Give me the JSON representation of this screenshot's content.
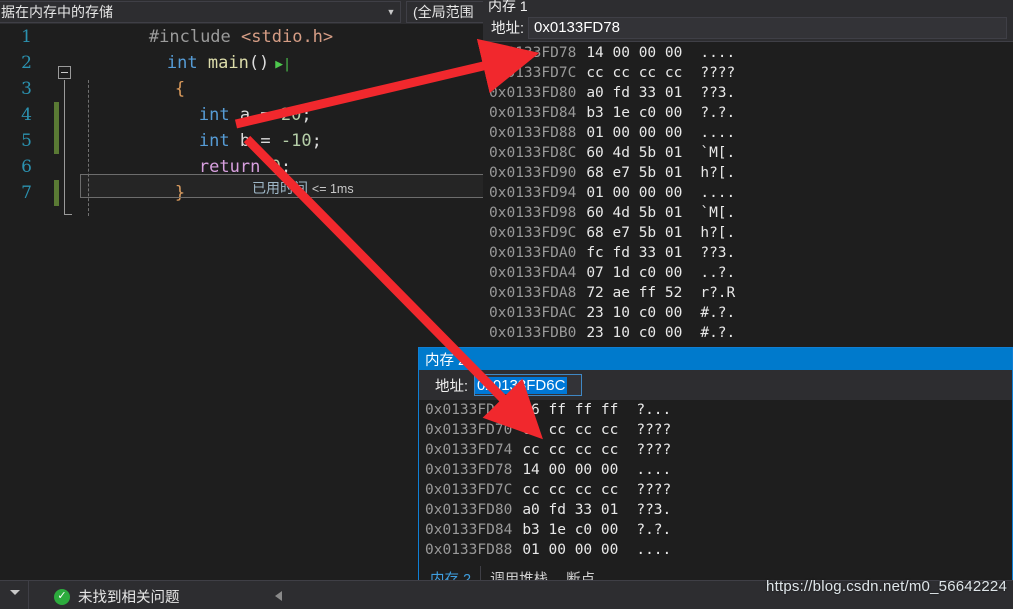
{
  "topbar": {
    "scope_combo": "据在内存中的存储",
    "scope_caret": "▼",
    "member_combo": "(全局范围"
  },
  "editor": {
    "lines": [
      {
        "num": "1",
        "changed": false,
        "text": "    #include <stdio.h>"
      },
      {
        "num": "2",
        "changed": false,
        "text": "int main()"
      },
      {
        "num": "3",
        "changed": false,
        "text": "    {"
      },
      {
        "num": "4",
        "changed": true,
        "text": "        int a = 20;"
      },
      {
        "num": "5",
        "changed": true,
        "text": "        int b = -10;"
      },
      {
        "num": "6",
        "changed": false,
        "text": "        return 0;"
      },
      {
        "num": "7",
        "changed": true,
        "text": "    }"
      }
    ],
    "elapsed_label": "已用时间",
    "elapsed_value": "<= 1ms",
    "tok": {
      "include": "#include",
      "header": "<stdio.h>",
      "int": "int",
      "main": "main",
      "parens": "()",
      "brace_open": "{",
      "brace_close": "}",
      "var_a": "a",
      "var_b": "b",
      "eq": "=",
      "num20": "20",
      "numneg10": "-10",
      "semi": ";",
      "return": "return",
      "num0": "0"
    }
  },
  "memory1": {
    "title": "内存 1",
    "address_label": "地址:",
    "address_value": "0x0133FD78",
    "rows": [
      {
        "addr": "0x0133FD78",
        "hex": "14 00 00 00",
        "ascii": "...."
      },
      {
        "addr": "0x0133FD7C",
        "hex": "cc cc cc cc",
        "ascii": "????"
      },
      {
        "addr": "0x0133FD80",
        "hex": "a0 fd 33 01",
        "ascii": "??3."
      },
      {
        "addr": "0x0133FD84",
        "hex": "b3 1e c0 00",
        "ascii": "?.?."
      },
      {
        "addr": "0x0133FD88",
        "hex": "01 00 00 00",
        "ascii": "...."
      },
      {
        "addr": "0x0133FD8C",
        "hex": "60 4d 5b 01",
        "ascii": "`M[."
      },
      {
        "addr": "0x0133FD90",
        "hex": "68 e7 5b 01",
        "ascii": "h?[."
      },
      {
        "addr": "0x0133FD94",
        "hex": "01 00 00 00",
        "ascii": "...."
      },
      {
        "addr": "0x0133FD98",
        "hex": "60 4d 5b 01",
        "ascii": "`M[."
      },
      {
        "addr": "0x0133FD9C",
        "hex": "68 e7 5b 01",
        "ascii": "h?[."
      },
      {
        "addr": "0x0133FDA0",
        "hex": "fc fd 33 01",
        "ascii": "??3."
      },
      {
        "addr": "0x0133FDA4",
        "hex": "07 1d c0 00",
        "ascii": "..?."
      },
      {
        "addr": "0x0133FDA8",
        "hex": "72 ae ff 52",
        "ascii": "r?.R"
      },
      {
        "addr": "0x0133FDAC",
        "hex": "23 10 c0 00",
        "ascii": "#.?."
      },
      {
        "addr": "0x0133FDB0",
        "hex": "23 10 c0 00",
        "ascii": "#.?."
      }
    ]
  },
  "memory2": {
    "title": "内存 2",
    "address_label": "地址:",
    "address_value": "0x0133FD6C",
    "rows": [
      {
        "addr": "0x0133FD6C",
        "hex": "f6 ff ff ff",
        "ascii": "?..."
      },
      {
        "addr": "0x0133FD70",
        "hex": "cc cc cc cc",
        "ascii": "????"
      },
      {
        "addr": "0x0133FD74",
        "hex": "cc cc cc cc",
        "ascii": "????"
      },
      {
        "addr": "0x0133FD78",
        "hex": "14 00 00 00",
        "ascii": "...."
      },
      {
        "addr": "0x0133FD7C",
        "hex": "cc cc cc cc",
        "ascii": "????"
      },
      {
        "addr": "0x0133FD80",
        "hex": "a0 fd 33 01",
        "ascii": "??3."
      },
      {
        "addr": "0x0133FD84",
        "hex": "b3 1e c0 00",
        "ascii": "?.?."
      },
      {
        "addr": "0x0133FD88",
        "hex": "01 00 00 00",
        "ascii": "...."
      }
    ],
    "tabs": [
      {
        "label": "内存 2",
        "active": true
      },
      {
        "label": "调用堆栈",
        "active": false
      },
      {
        "label": "断点",
        "active": false
      }
    ]
  },
  "statusbar": {
    "ok_icon": "check-circle-icon",
    "ok_glyph": "✓",
    "message": "未找到相关问题"
  },
  "watermark": {
    "url": "https://blog.csdn.net/m0_56642224"
  },
  "colors": {
    "accent_blue": "#007acc",
    "arrow_red": "#f1282d",
    "change_green": "#5a7a34",
    "ok_green": "#2cab3d",
    "editor_bg": "#1e1e1e",
    "chrome_bg": "#2d2d30"
  }
}
